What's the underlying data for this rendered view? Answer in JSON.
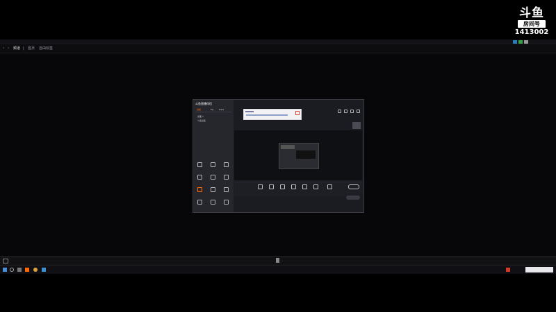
{
  "badge": {
    "logo": "斗鱼",
    "room_label": "房间号",
    "room_number": "1413002"
  },
  "outer_window": {
    "tabs": [
      "频道",
      "首页",
      "自由标签"
    ]
  },
  "inner_app": {
    "title": "斗鱼直播伴侣",
    "side_tabs": [
      "当前",
      "My",
      "Data"
    ],
    "scene_items": [
      "桌面 1",
      "斗鱼采集"
    ],
    "tools": [
      {
        "name": "grid-icon"
      },
      {
        "name": "mic-icon"
      },
      {
        "name": "cloud-icon"
      },
      {
        "name": "gift-icon"
      },
      {
        "name": "pin-icon"
      },
      {
        "name": "image-icon"
      },
      {
        "name": "game-icon"
      },
      {
        "name": "chart-icon"
      },
      {
        "name": "settings-icon"
      },
      {
        "name": "box-icon"
      },
      {
        "name": "wave-icon"
      },
      {
        "name": "up-icon"
      }
    ],
    "bottom_tools": 7,
    "accent": "#ff6a00"
  },
  "colors": {
    "background": "#000000",
    "popup": "#f2f2f4",
    "douyu_orange": "#ff6a00",
    "taskbar_blue": "#2c7fb8"
  }
}
